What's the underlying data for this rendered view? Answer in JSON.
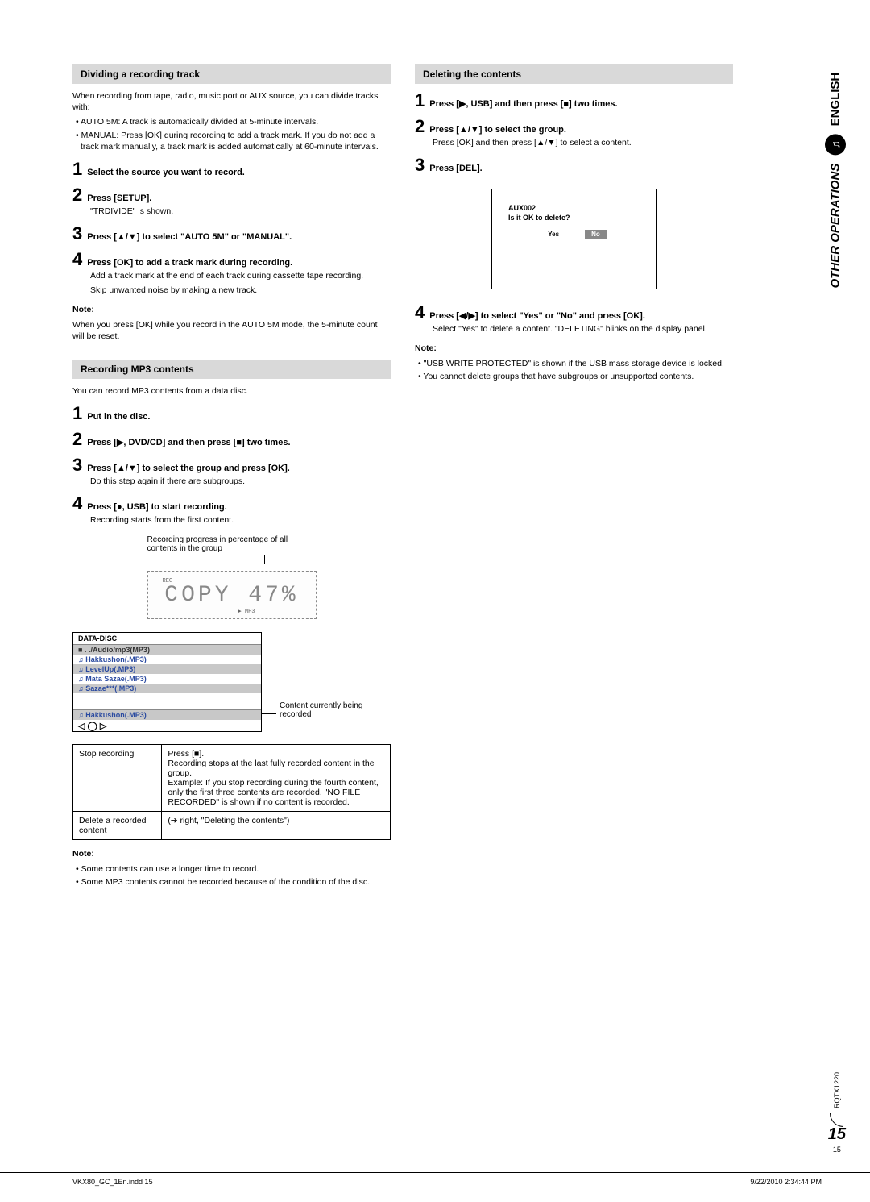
{
  "side": {
    "other_ops": "OTHER OPERATIONS",
    "english": "ENGLISH",
    "music_icon": "♫"
  },
  "left": {
    "dividing": {
      "header": "Dividing a recording track",
      "intro": "When recording from tape, radio, music port or AUX source, you can divide tracks with:",
      "bul1": "• AUTO 5M: A track is automatically divided at 5-minute intervals.",
      "bul2": "• MANUAL: Press [OK] during recording to add a track mark. If you do not add a track mark manually, a track mark is added automatically at 60-minute intervals.",
      "s1": "Select the source you want to record.",
      "s2": "Press [SETUP].",
      "s2b": "\"TRDIVIDE\" is shown.",
      "s3": "Press [▲/▼] to select \"AUTO 5M\" or \"MANUAL\".",
      "s4": "Press [OK] to add a track mark during recording.",
      "s4b": "Add a track mark at the end of each track during cassette tape recording.",
      "s4c": "Skip unwanted noise by making a new track.",
      "note_l": "Note:",
      "note": "When you press [OK] while you record in the AUTO 5M mode, the 5-minute count will be reset."
    },
    "mp3": {
      "header": "Recording MP3 contents",
      "intro": "You can record MP3 contents from a data disc.",
      "s1": "Put in the disc.",
      "s2": "Press [▶, DVD/CD] and then press [■] two times.",
      "s3": "Press [▲/▼] to select the group and press [OK].",
      "s3b": "Do this step again if there are subgroups.",
      "s4": "Press [●, USB] to start recording.",
      "s4b": "Recording starts from the first content.",
      "caption": "Recording progress in percentage of all contents in the group",
      "display_text": "COPY 47%",
      "display_rec": "REC",
      "display_mp3": "▶ MP3",
      "disc_header": "DATA-DISC",
      "disc_row0": "■ . ./Audio/mp3(MP3)",
      "disc_row1": "♫ Hakkushon(.MP3)",
      "disc_row2": "♫ LevelUp(.MP3)",
      "disc_row3": "♫ Mata Sazae(.MP3)",
      "disc_row4": "♫ Sazae***(.MP3)",
      "disc_current": "♫ Hakkushon(.MP3)",
      "disc_nav": "◁ ◯ ▷",
      "annot": "Content currently being recorded",
      "tbl_r1a": "Stop recording",
      "tbl_r1b": "Press [■].\nRecording stops at the last fully recorded content in the group.\nExample: If you stop recording during the fourth content, only the first three contents are recorded. \"NO FILE RECORDED\" is shown if no content is recorded.",
      "tbl_r2a": "Delete a recorded content",
      "tbl_r2b": "(➔ right, \"Deleting the contents\")",
      "note_l": "Note:",
      "note1": "• Some contents can use a longer time to record.",
      "note2": "• Some MP3 contents cannot be recorded because of the condition of the disc."
    }
  },
  "right": {
    "deleting": {
      "header": "Deleting the contents",
      "s1": "Press [▶, USB] and then press [■] two times.",
      "s2": "Press [▲/▼] to select the group.",
      "s2b": "Press [OK] and then press [▲/▼] to select a content.",
      "s3": "Press [DEL].",
      "dlg_t": "AUX002",
      "dlg_q": "Is it OK to delete?",
      "dlg_yes": "Yes",
      "dlg_no": "No",
      "s4": "Press [◀/▶] to select \"Yes\" or \"No\" and press [OK].",
      "s4b": "Select \"Yes\" to delete a content. \"DELETING\" blinks on the display panel.",
      "note_l": "Note:",
      "note1": "• \"USB WRITE PROTECTED\" is shown if the USB mass storage device is locked.",
      "note2": "• You cannot delete groups that have subgroups or unsupported contents."
    }
  },
  "pagenum": {
    "docid": "RQTX1220",
    "big": "15",
    "small": "15"
  },
  "footer": {
    "left": "VKX80_GC_1En.indd   15",
    "right": "9/22/2010   2:34:44 PM"
  }
}
